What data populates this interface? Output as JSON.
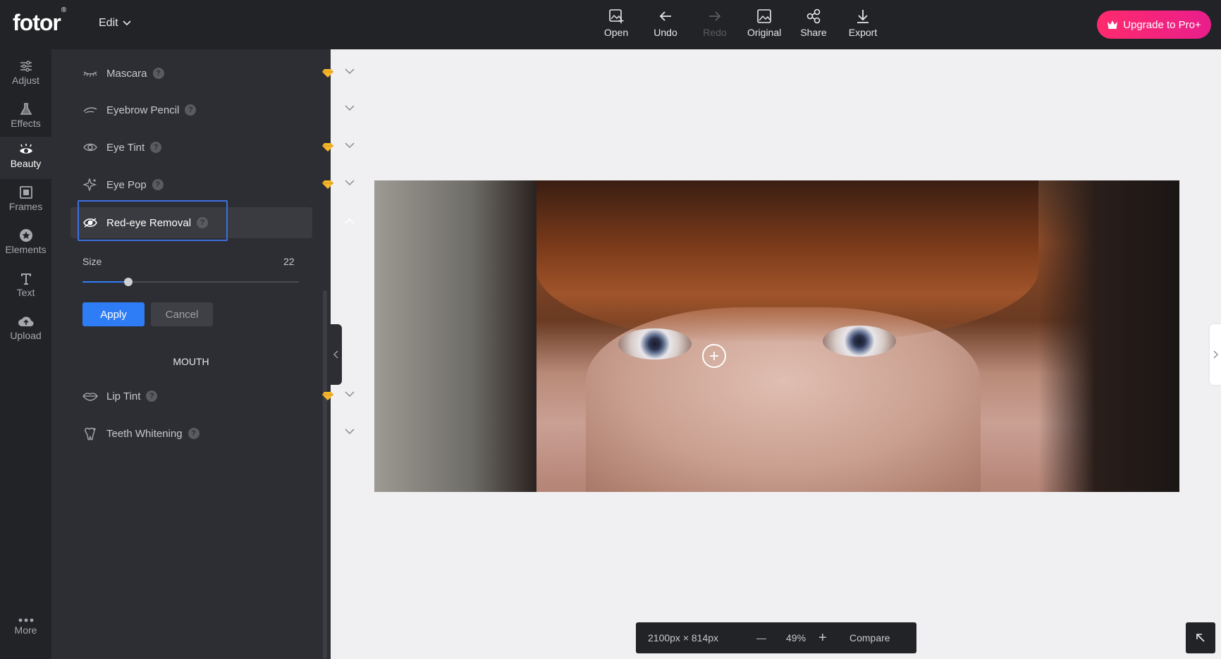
{
  "app": {
    "logo": "fotor",
    "logo_mark": "®",
    "edit_menu_label": "Edit",
    "upgrade_label": "Upgrade to Pro+",
    "upgrade_color": "#ff1a7d",
    "accent_color": "#2f7df6"
  },
  "toolbar": {
    "open": "Open",
    "undo": "Undo",
    "redo": "Redo",
    "original": "Original",
    "share": "Share",
    "export": "Export"
  },
  "rail": {
    "adjust": "Adjust",
    "effects": "Effects",
    "beauty": "Beauty",
    "frames": "Frames",
    "elements": "Elements",
    "text": "Text",
    "upload": "Upload",
    "more": "More",
    "active": "Beauty"
  },
  "panel": {
    "items": [
      {
        "label": "Mascara",
        "help": "?",
        "icon": "mascara-icon",
        "premium": true
      },
      {
        "label": "Eyebrow Pencil",
        "help": "?",
        "icon": "eyebrow-icon",
        "premium": false
      },
      {
        "label": "Eye Tint",
        "help": "?",
        "icon": "eye-icon",
        "premium": true
      },
      {
        "label": "Eye Pop",
        "help": "?",
        "icon": "sparkle-icon",
        "premium": true
      },
      {
        "label": "Red-eye Removal",
        "help": "?",
        "icon": "eye-icon",
        "premium": false,
        "expanded": true
      }
    ],
    "size_label": "Size",
    "size_value": "22",
    "size_fraction": 0.21,
    "apply_label": "Apply",
    "cancel_label": "Cancel",
    "mouth_section": "MOUTH",
    "mouth_items": [
      {
        "label": "Lip Tint",
        "help": "?",
        "icon": "lips-icon",
        "premium": true
      },
      {
        "label": "Teeth Whitening",
        "help": "?",
        "icon": "tooth-icon",
        "premium": false
      }
    ]
  },
  "status": {
    "dimensions": "2100px × 814px",
    "zoom_out": "—",
    "zoom": "49%",
    "zoom_in": "+",
    "compare": "Compare"
  }
}
